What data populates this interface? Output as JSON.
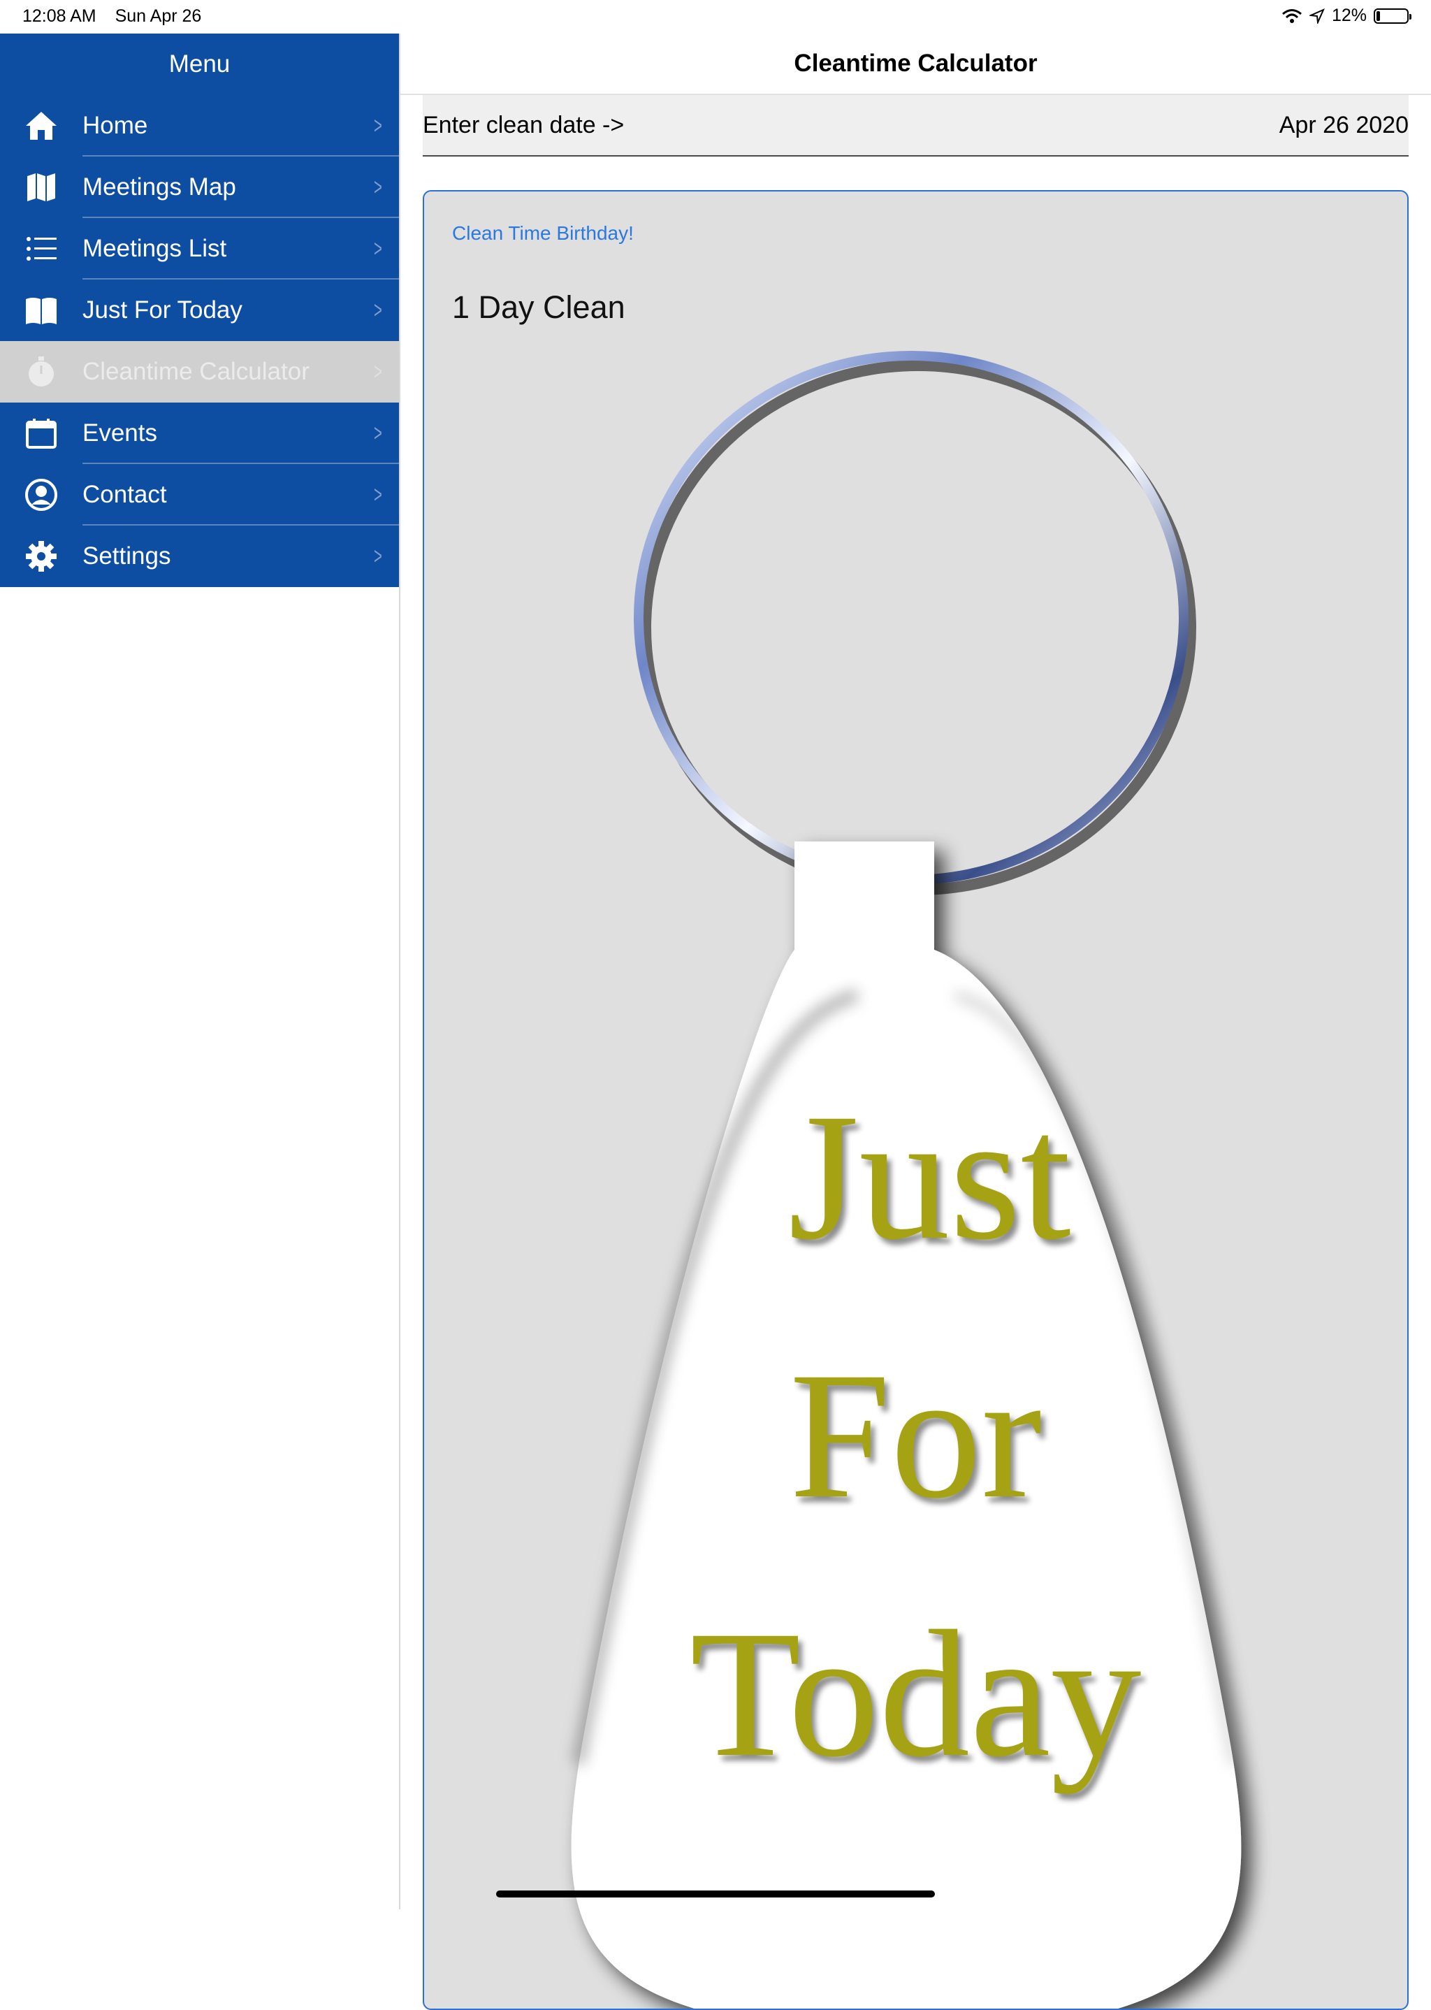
{
  "status_bar": {
    "time": "12:08 AM",
    "date": "Sun Apr 26",
    "battery": "12%",
    "battery_level": 0.12
  },
  "sidebar": {
    "title": "Menu",
    "items": [
      {
        "label": "Home",
        "icon": "home-icon",
        "active": false
      },
      {
        "label": "Meetings Map",
        "icon": "map-icon",
        "active": false
      },
      {
        "label": "Meetings List",
        "icon": "list-icon",
        "active": false
      },
      {
        "label": "Just For Today",
        "icon": "book-icon",
        "active": false
      },
      {
        "label": "Cleantime Calculator",
        "icon": "stopwatch-icon",
        "active": true
      },
      {
        "label": "Events",
        "icon": "calendar-icon",
        "active": false
      },
      {
        "label": "Contact",
        "icon": "person-icon",
        "active": false
      },
      {
        "label": "Settings",
        "icon": "gear-icon",
        "active": false
      }
    ],
    "chevron": ">"
  },
  "main": {
    "title": "Cleantime Calculator",
    "date_prompt": "Enter clean date ->",
    "date_value": "Apr 26 2020",
    "card": {
      "birthday_label": "Clean Time Birthday!",
      "clean_text": "1 Day Clean",
      "keytag_lines": [
        "Just",
        "For",
        "Today"
      ]
    }
  },
  "colors": {
    "menu_blue": "#0d4ea3",
    "active_gray": "#d0d0d0",
    "link_blue": "#2a79e0",
    "keytag_text": "#a5a313"
  }
}
